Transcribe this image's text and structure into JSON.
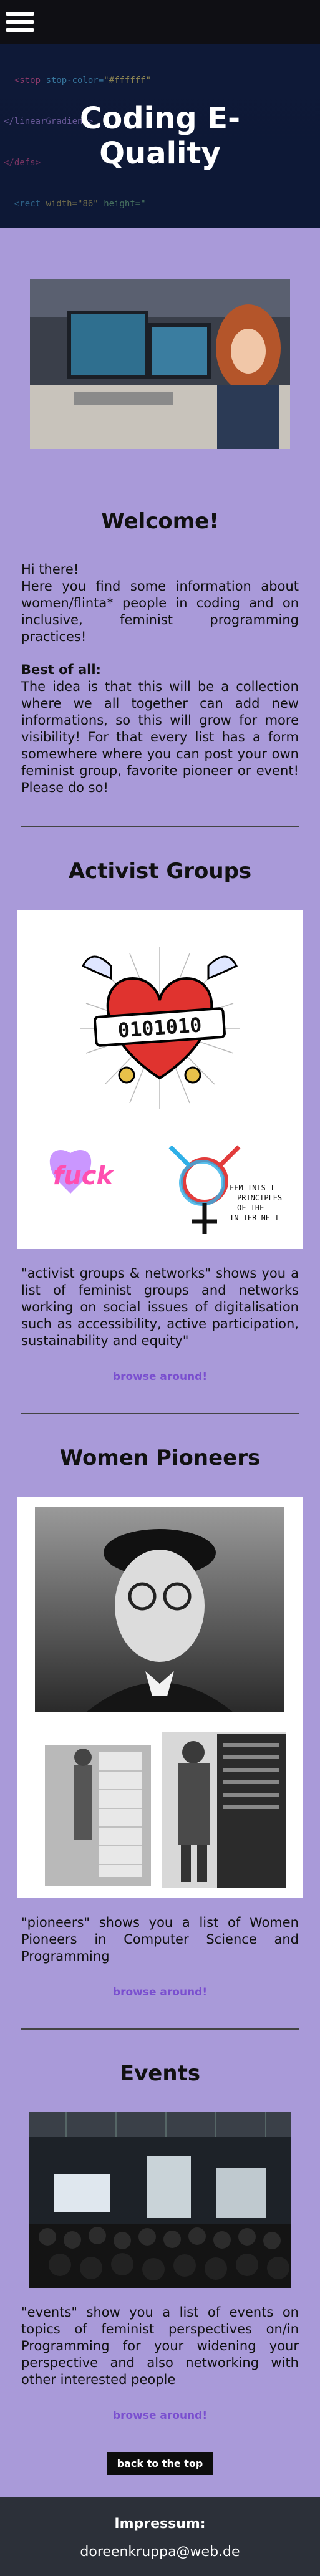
{
  "hero": {
    "title": "Coding E-Quality"
  },
  "welcome": {
    "title": "Welcome!",
    "intro": "Hi there!\nHere you find some information about women/flinta* people in coding and on inclusive, feminist programming practices!",
    "best_label": "Best of all:",
    "best_text": "The idea is that this will be a collection where we all together can add new informations, so this will grow for more visibility! For that every list has a form somewhere where you can post your own feminist group, favorite pioneer or event! Please do so!"
  },
  "activist": {
    "title": "Activist Groups",
    "binary": "0101010",
    "sticker_text": "fuck",
    "manifesto": [
      "FEM INIS T",
      "PRINCIPLES",
      "OF THE",
      "IN TER NE T"
    ],
    "desc": "\"activist groups & networks\" shows you a list of feminist groups and networks working on social issues of digitalisation such as accessibility, active participation, sustainability and equity\"",
    "link": "browse around!"
  },
  "pioneers": {
    "title": "Women Pioneers",
    "desc": "\"pioneers\" shows you a list of Women Pioneers in Computer Science and Programming",
    "link": "browse around!"
  },
  "events": {
    "title": "Events",
    "desc": "\"events\" show you a list of events on topics of feminist perspectives on/in Programming for your widening your perspective and also networking with other interested people",
    "link": "browse around!"
  },
  "back_to_top": "back to the top",
  "footer": {
    "impressum": "Impressum:",
    "email": "doreenkruppa@web.de"
  },
  "colors": {
    "page": "#a99ad9",
    "link": "#7a4fcf",
    "footer": "#2c3039",
    "topbar": "#0f0f14"
  }
}
